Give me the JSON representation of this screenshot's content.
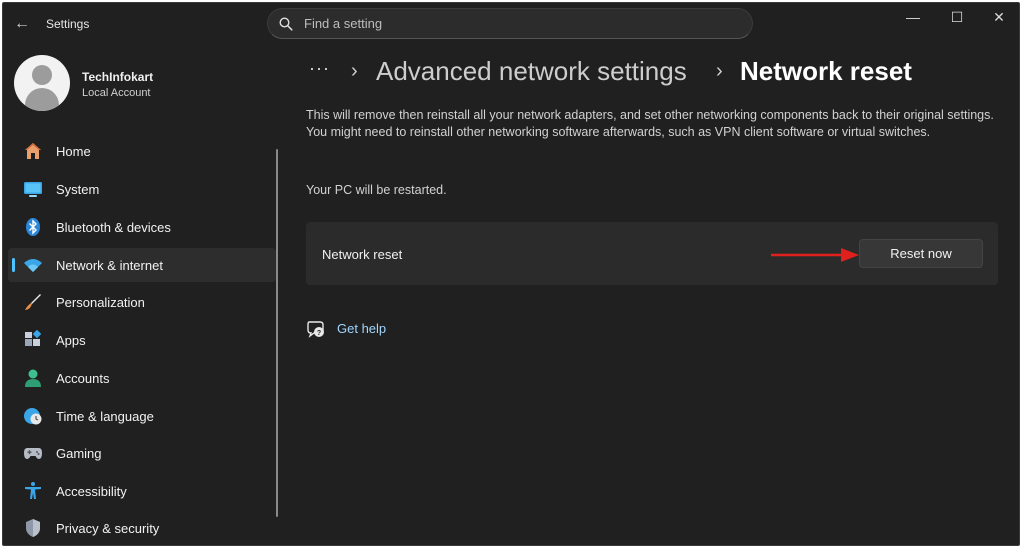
{
  "window": {
    "title": "Settings",
    "controls": {
      "minimize": "—",
      "maximize": "☐",
      "close": "✕"
    }
  },
  "search": {
    "placeholder": "Find a setting",
    "value": ""
  },
  "profile": {
    "name": "TechInfokart",
    "account_type": "Local Account"
  },
  "sidebar": {
    "items": [
      {
        "label": "Home",
        "icon": "home-icon",
        "active": false
      },
      {
        "label": "System",
        "icon": "monitor-icon",
        "active": false
      },
      {
        "label": "Bluetooth & devices",
        "icon": "bluetooth-icon",
        "active": false
      },
      {
        "label": "Network & internet",
        "icon": "wifi-icon",
        "active": true
      },
      {
        "label": "Personalization",
        "icon": "brush-icon",
        "active": false
      },
      {
        "label": "Apps",
        "icon": "apps-icon",
        "active": false
      },
      {
        "label": "Accounts",
        "icon": "person-icon",
        "active": false
      },
      {
        "label": "Time & language",
        "icon": "globe-clock-icon",
        "active": false
      },
      {
        "label": "Gaming",
        "icon": "gamepad-icon",
        "active": false
      },
      {
        "label": "Accessibility",
        "icon": "accessibility-icon",
        "active": false
      },
      {
        "label": "Privacy & security",
        "icon": "shield-icon",
        "active": false
      }
    ]
  },
  "breadcrumb": {
    "ellipsis": "···",
    "separator": "›",
    "parent": "Advanced network settings",
    "current": "Network reset"
  },
  "main": {
    "description": "This will remove then reinstall all your network adapters, and set other networking components back to their original settings. You might need to reinstall other networking software afterwards, such as VPN client software or virtual switches.",
    "restart_note": "Your PC will be restarted.",
    "card": {
      "label": "Network reset",
      "button": "Reset now"
    },
    "help_link": "Get help"
  },
  "colors": {
    "accent": "#4cc2ff",
    "background": "#202020",
    "card": "#2b2b2b",
    "annotation_arrow": "#e0201c"
  }
}
